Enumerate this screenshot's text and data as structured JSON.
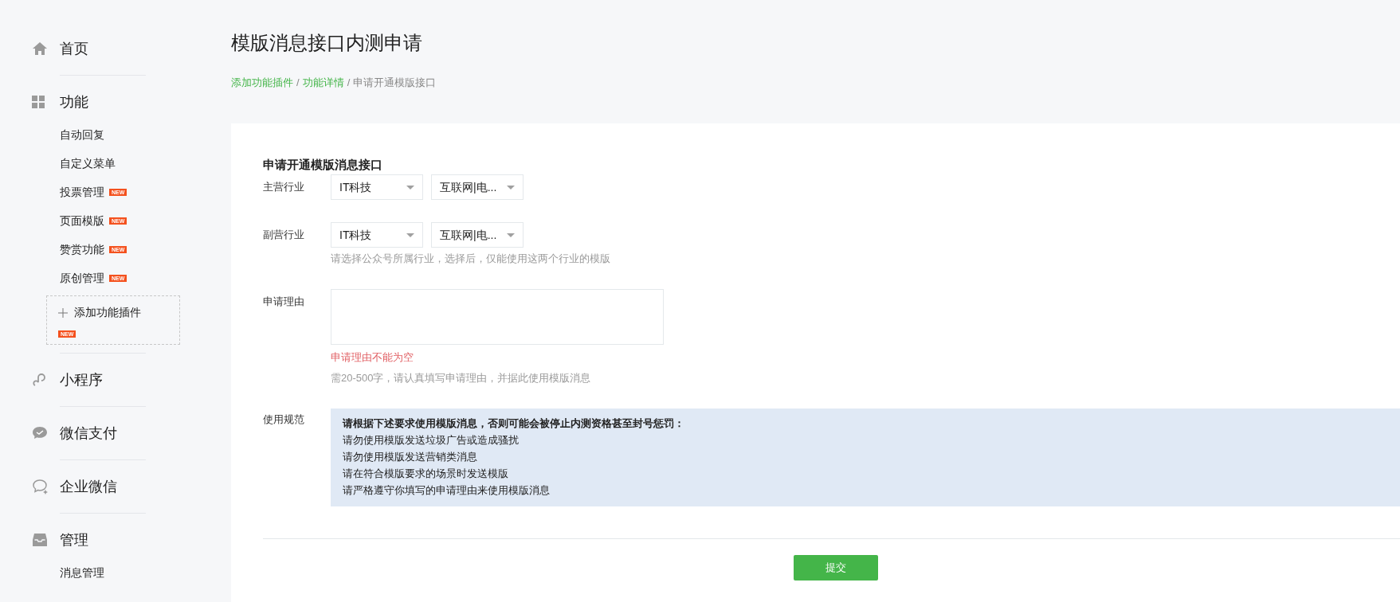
{
  "sidebar": {
    "sections": [
      {
        "label": "首页"
      },
      {
        "label": "功能",
        "items": [
          {
            "label": "自动回复"
          },
          {
            "label": "自定义菜单"
          },
          {
            "label": "投票管理",
            "badge": "NEW"
          },
          {
            "label": "页面模版",
            "badge": "NEW"
          },
          {
            "label": "赞赏功能",
            "badge": "NEW"
          },
          {
            "label": "原创管理",
            "badge": "NEW"
          }
        ],
        "add_plugin": {
          "label": "添加功能插件",
          "badge": "NEW"
        }
      },
      {
        "label": "小程序"
      },
      {
        "label": "微信支付"
      },
      {
        "label": "企业微信"
      },
      {
        "label": "管理",
        "items": [
          {
            "label": "消息管理"
          }
        ]
      }
    ]
  },
  "page": {
    "title": "模版消息接口内测申请",
    "breadcrumb": [
      {
        "label": "添加功能插件",
        "kind": "link"
      },
      {
        "label": "功能详情",
        "kind": "link"
      },
      {
        "label": "申请开通模版接口",
        "kind": "current"
      }
    ],
    "separator": "/"
  },
  "form": {
    "heading": "申请开通模版消息接口",
    "primary_industry": {
      "label": "主营行业",
      "selects": [
        "IT科技",
        "互联网|电..."
      ]
    },
    "secondary_industry": {
      "label": "副营行业",
      "selects": [
        "IT科技",
        "互联网|电..."
      ],
      "hint": "请选择公众号所属行业，选择后，仅能使用这两个行业的模版"
    },
    "reason": {
      "label": "申请理由",
      "error": "申请理由不能为空",
      "hint": "需20-500字，请认真填写申请理由，并据此使用模版消息"
    },
    "rules": {
      "label": "使用规范",
      "heading": "请根据下述要求使用模版消息，否则可能会被停止内测资格甚至封号惩罚：",
      "lines": [
        "请勿使用模版发送垃圾广告或造成骚扰",
        "请勿使用模版发送营销类消息",
        "请在符合模版要求的场景时发送模版",
        "请严格遵守你填写的申请理由来使用模版消息"
      ]
    },
    "submit": "提交"
  }
}
